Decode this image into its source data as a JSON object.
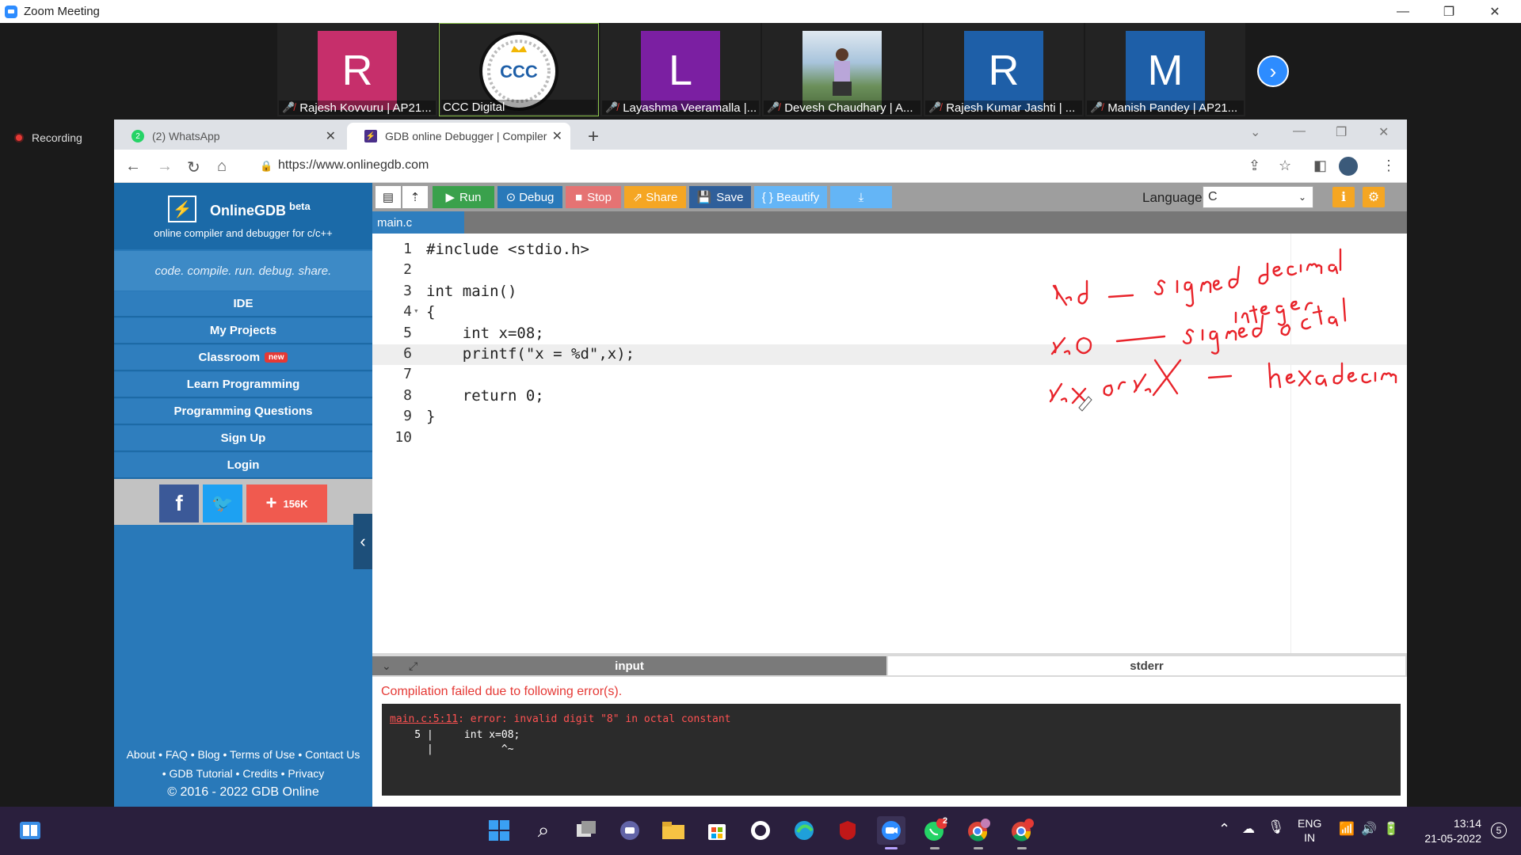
{
  "zoom": {
    "title": "Zoom Meeting",
    "recording_label": "Recording",
    "participants": [
      {
        "initial": "R",
        "color": "#c62f6b",
        "name": "Rajesh Kovvuru | AP21..."
      },
      {
        "initial": "",
        "color": "#ffffff",
        "name": "CCC Digital",
        "logo_text": "CCC"
      },
      {
        "initial": "L",
        "color": "#7b1fa2",
        "name": "Layashma Veeramalla |..."
      },
      {
        "initial": "",
        "color": "#6b8ca8",
        "name": "Devesh Chaudhary | A..."
      },
      {
        "initial": "R",
        "color": "#1e5fa8",
        "name": "Rajesh Kumar Jashti | ..."
      },
      {
        "initial": "M",
        "color": "#1e5fa8",
        "name": "Manish Pandey | AP21..."
      }
    ]
  },
  "browser": {
    "tabs": [
      {
        "label": "(2) WhatsApp",
        "badge": "2"
      },
      {
        "label": "GDB online Debugger | Compiler"
      }
    ],
    "url": "https://www.onlinegdb.com"
  },
  "site": {
    "brand": "OnlineGDB",
    "brand_sup": "beta",
    "tagline": "online compiler and debugger for c/c++",
    "slogan": "code. compile. run. debug. share.",
    "menu": [
      "IDE",
      "My Projects",
      "Classroom",
      "Learn Programming",
      "Programming Questions",
      "Sign Up",
      "Login"
    ],
    "classroom_badge": "new",
    "share_count": "156K",
    "footer_line1": "About • FAQ • Blog • Terms of Use • Contact Us",
    "footer_line2": "• GDB Tutorial • Credits • Privacy",
    "copyright": "© 2016 - 2022 GDB Online"
  },
  "toolbar": {
    "run": "Run",
    "debug": "Debug",
    "stop": "Stop",
    "share": "Share",
    "save": "Save",
    "beautify": "{ } Beautify",
    "language_label": "Language",
    "language_value": "C"
  },
  "file_tab": "main.c",
  "code_lines": [
    "#include <stdio.h>",
    "",
    "int main()",
    "{",
    "    int x=08;",
    "    printf(\"x = %d\",x);",
    "",
    "    return 0;",
    "}",
    ""
  ],
  "annotations": {
    "l1": "%d — signed decimal integer",
    "l2": "%o — signed octal",
    "l3": "%x or %X — hexadecima"
  },
  "io": {
    "input_tab": "input",
    "stderr_tab": "stderr",
    "compile_msg": "Compilation failed due to following error(s).",
    "err_loc": "main.c:5:11",
    "err_text": ": error: invalid digit \"8\" in octal constant",
    "err_line2": "    5 |     int x=08;",
    "err_line3": "      |           ^~"
  },
  "taskbar": {
    "lang": "ENG",
    "region": "IN",
    "time": "13:14",
    "date": "21-05-2022",
    "notif": "5",
    "whatsapp_badge": "2"
  }
}
